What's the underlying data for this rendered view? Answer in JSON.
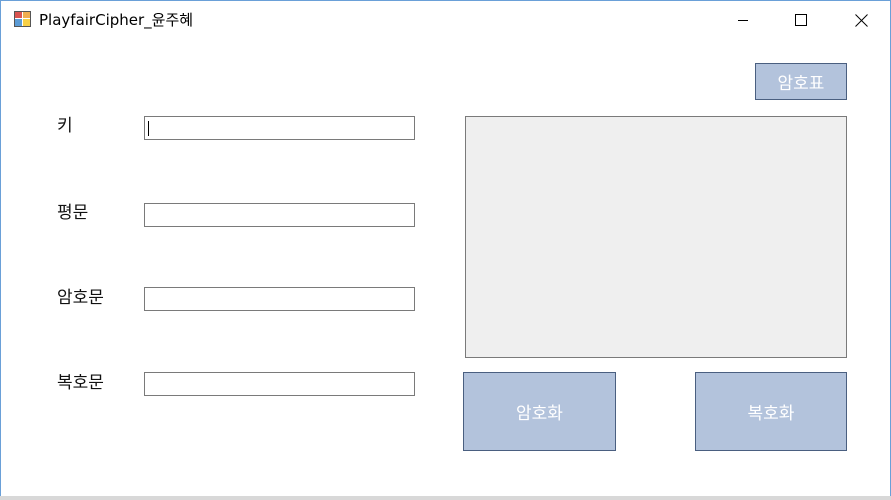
{
  "window": {
    "title": "PlayfairCipher_윤주혜"
  },
  "form": {
    "key_label": "키",
    "plaintext_label": "평문",
    "ciphertext_label": "암호문",
    "decrypted_label": "복호문",
    "key_value": "",
    "plaintext_value": "",
    "ciphertext_value": "",
    "decrypted_value": ""
  },
  "buttons": {
    "cipher_table": "암호표",
    "encrypt": "암호화",
    "decrypt": "복호화"
  },
  "colors": {
    "button_bg": "#b3c3dc",
    "panel_bg": "#efefef"
  }
}
